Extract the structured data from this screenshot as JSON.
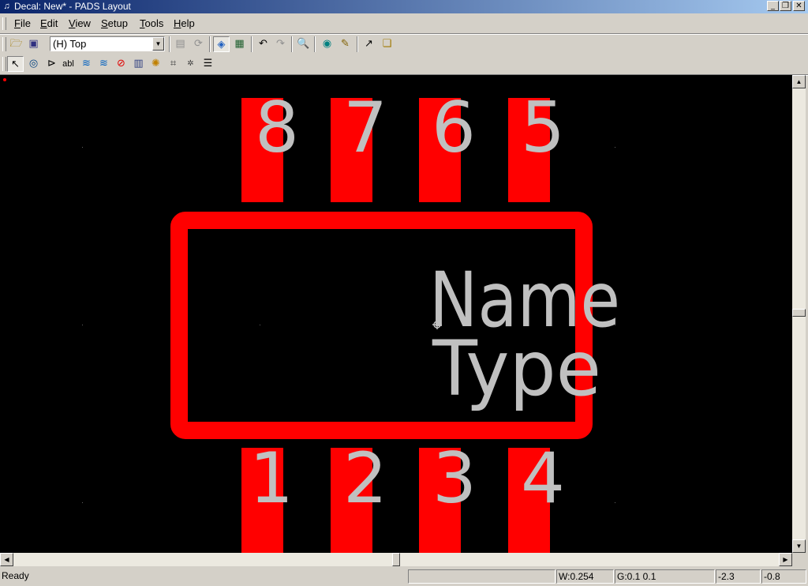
{
  "window": {
    "title": "Decal: New* - PADS Layout"
  },
  "menu": {
    "items": [
      "File",
      "Edit",
      "View",
      "Setup",
      "Tools",
      "Help"
    ],
    "mnemonics": [
      "F",
      "E",
      "V",
      "S",
      "T",
      "H"
    ]
  },
  "toolbar": {
    "layer_value": "(H) Top"
  },
  "decal": {
    "pins_top": [
      "8",
      "7",
      "6",
      "5"
    ],
    "pins_bottom": [
      "1",
      "2",
      "3",
      "4"
    ],
    "name_label": "Name",
    "type_label": "Type"
  },
  "colors": {
    "pad": "#ff0000",
    "outline": "#ff0000",
    "text": "#c0c0c0",
    "background": "#000000"
  },
  "status": {
    "message": "Ready",
    "width": "W:0.254",
    "grid": "G:0.1 0.1",
    "x": "-2.3",
    "y": "-0.8"
  },
  "icons": {
    "toolbar1": [
      "open-folder-icon",
      "save-icon",
      "layer-props-icon",
      "refresh-icon",
      "display-colors-icon",
      "drafting-icon",
      "undo-icon",
      "redo-icon",
      "zoom-icon",
      "view-icon",
      "highlight-icon",
      "export-icon",
      "windows-icon"
    ],
    "toolbar2": [
      "select-arrow-icon",
      "terminal-icon",
      "pin-icon",
      "text-ab-icon",
      "copper-icon",
      "copper-cutout-icon",
      "keepout-icon",
      "2d-line-icon",
      "explode-icon",
      "wizard-icon",
      "dxf-icon",
      "properties-icon"
    ]
  }
}
